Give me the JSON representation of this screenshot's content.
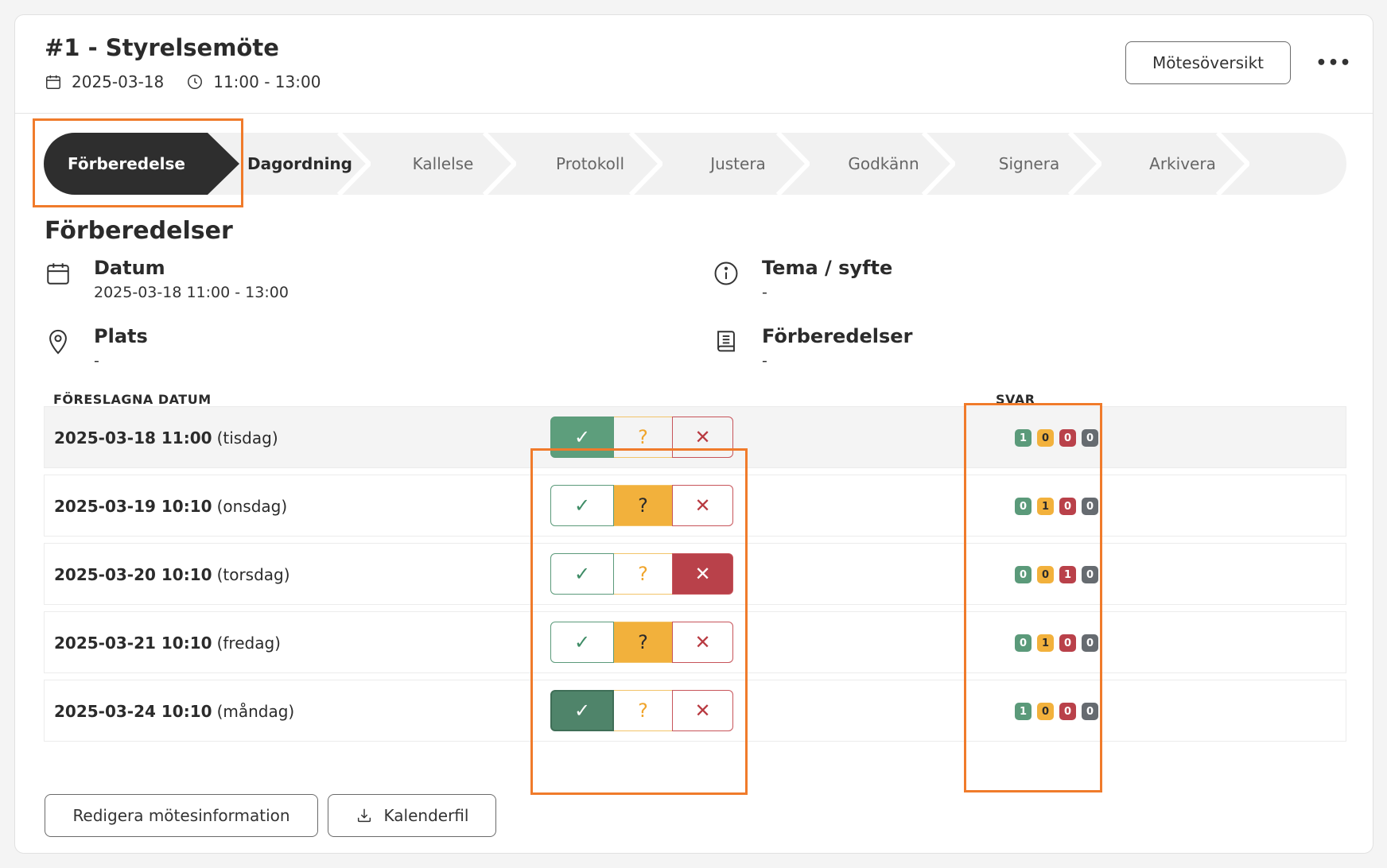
{
  "header": {
    "title": "#1 - Styrelsemöte",
    "date": "2025-03-18",
    "time": "11:00 - 13:00",
    "overview_label": "Mötesöversikt",
    "more_label": "•••"
  },
  "stepper": {
    "active": "Förberedelse",
    "steps": [
      "Dagordning",
      "Kallelse",
      "Protokoll",
      "Justera",
      "Godkänn",
      "Signera",
      "Arkivera"
    ]
  },
  "section": {
    "title": "Förberedelser",
    "datum_label": "Datum",
    "datum_value": "2025-03-18 11:00 - 13:00",
    "plats_label": "Plats",
    "plats_value": "-",
    "tema_label": "Tema / syfte",
    "tema_value": "-",
    "forb_label": "Förberedelser",
    "forb_value": "-"
  },
  "table": {
    "col_dates": "FÖRESLAGNA DATUM",
    "col_answers": "SVAR",
    "rows": [
      {
        "date": "2025-03-18 11:00",
        "day": "(tisdag)",
        "yes": "1",
        "maybe": "0",
        "no": "0",
        "none": "0"
      },
      {
        "date": "2025-03-19 10:10",
        "day": "(onsdag)",
        "yes": "0",
        "maybe": "1",
        "no": "0",
        "none": "0"
      },
      {
        "date": "2025-03-20 10:10",
        "day": "(torsdag)",
        "yes": "0",
        "maybe": "0",
        "no": "1",
        "none": "0"
      },
      {
        "date": "2025-03-21 10:10",
        "day": "(fredag)",
        "yes": "0",
        "maybe": "1",
        "no": "0",
        "none": "0"
      },
      {
        "date": "2025-03-24 10:10",
        "day": "(måndag)",
        "yes": "1",
        "maybe": "0",
        "no": "0",
        "none": "0"
      }
    ],
    "vote_glyphs": {
      "yes": "✓",
      "maybe": "?",
      "no": "✕"
    }
  },
  "footer": {
    "edit_label": "Redigera mötesinformation",
    "calendar_label": "Kalenderfil"
  },
  "colors": {
    "accent_outline": "#f07b2b",
    "yes": "#5d9e7c",
    "maybe": "#f2b13c",
    "no": "#b9414a",
    "none": "#666b70"
  }
}
